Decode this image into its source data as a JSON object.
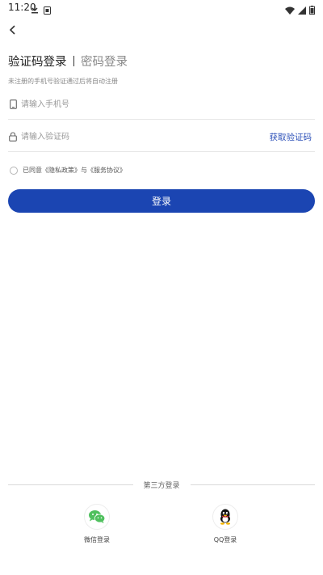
{
  "status_bar": {
    "time": "11:20"
  },
  "header": {
    "back_icon": "chevron-left-icon"
  },
  "tabs": {
    "active_label": "验证码登录",
    "inactive_label": "密码登录"
  },
  "hint": "未注册的手机号验证通过后将自动注册",
  "phone_field": {
    "placeholder": "请输入手机号",
    "icon": "phone-icon"
  },
  "code_field": {
    "placeholder": "请输入验证码",
    "icon": "lock-icon",
    "get_code_label": "获取验证码"
  },
  "agreement": {
    "text": "已同意《隐私政策》与《服务协议》"
  },
  "login_button": {
    "label": "登录"
  },
  "third_party": {
    "label": "第三方登录",
    "items": [
      {
        "label": "微信登录",
        "icon": "wechat-icon"
      },
      {
        "label": "QQ登录",
        "icon": "qq-icon"
      }
    ]
  },
  "colors": {
    "accent": "#1b45b2",
    "link": "#2b4fb8",
    "wechat": "#4fc05e"
  }
}
